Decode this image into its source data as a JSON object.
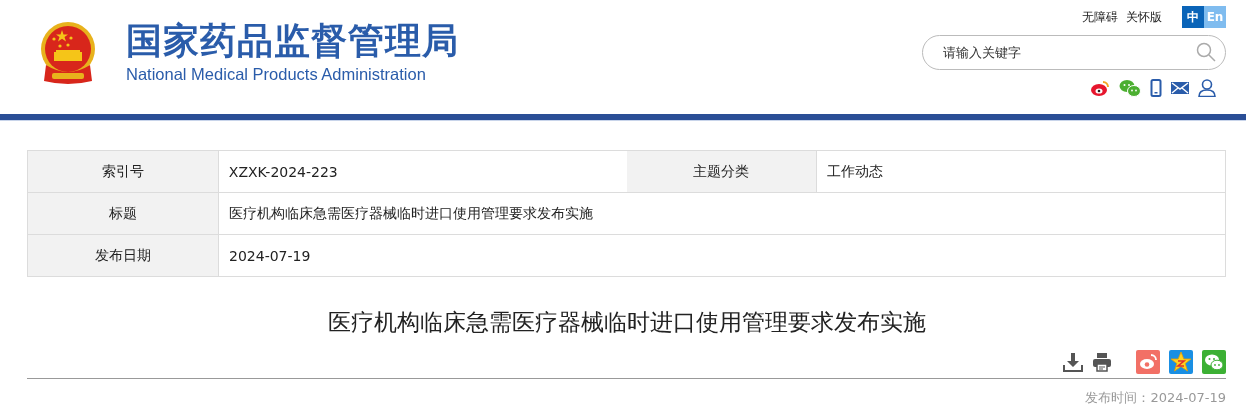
{
  "header": {
    "title": "国家药品监督管理局",
    "subtitle": "National Medical Products Administration",
    "links": [
      "无障碍",
      "关怀版"
    ],
    "languages": [
      {
        "label": "中",
        "selected": true
      },
      {
        "label": "En",
        "selected": false
      }
    ],
    "search": {
      "placeholder": "请输入关键字"
    }
  },
  "info_table": {
    "rows": [
      [
        {
          "label": "索引号",
          "value": "XZXK-2024-223"
        },
        {
          "label": "主题分类",
          "value": "工作动态"
        }
      ],
      [
        {
          "label": "标题",
          "value": "医疗机构临床急需医疗器械临时进口使用管理要求发布实施"
        }
      ],
      [
        {
          "label": "发布日期",
          "value": "2024-07-19"
        }
      ]
    ]
  },
  "article": {
    "title": "医疗机构临床急需医疗器械临时进口使用管理要求发布实施",
    "publish_time": "发布时间：2024-07-19"
  }
}
